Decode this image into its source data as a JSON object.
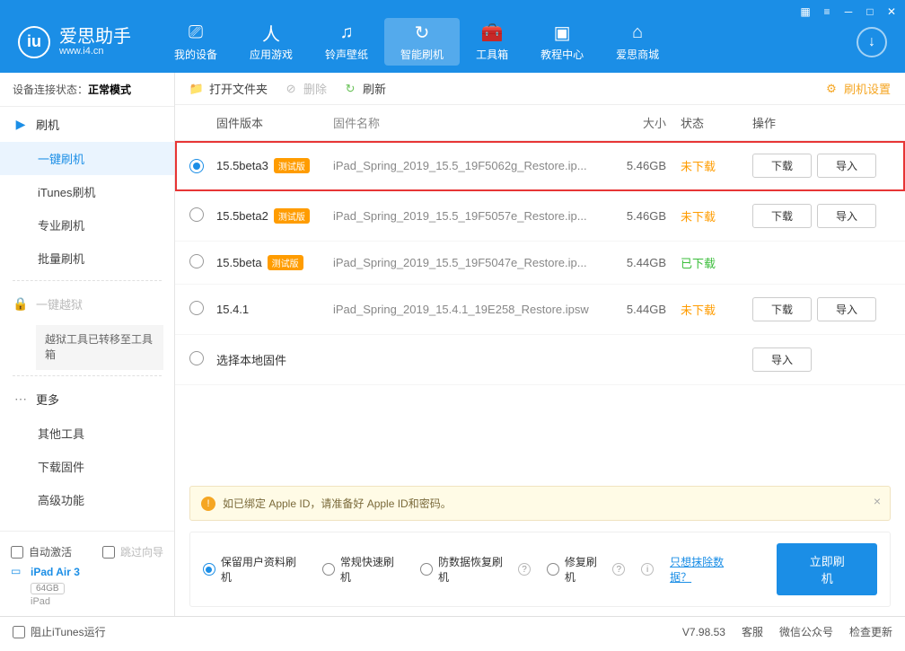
{
  "titlebar_icons": [
    "gift",
    "menu",
    "min",
    "max",
    "close"
  ],
  "logo": {
    "main": "爱思助手",
    "url": "www.i4.cn"
  },
  "nav": [
    {
      "label": "我的设备",
      "icon": "device"
    },
    {
      "label": "应用游戏",
      "icon": "apps"
    },
    {
      "label": "铃声壁纸",
      "icon": "ringtone"
    },
    {
      "label": "智能刷机",
      "icon": "refresh",
      "active": true
    },
    {
      "label": "工具箱",
      "icon": "toolbox"
    },
    {
      "label": "教程中心",
      "icon": "tutorial"
    },
    {
      "label": "爱思商城",
      "icon": "shop"
    }
  ],
  "conn_status": {
    "label": "设备连接状态：",
    "value": "正常模式"
  },
  "sidebar": {
    "group_flash": "刷机",
    "items_flash": [
      "一键刷机",
      "iTunes刷机",
      "专业刷机",
      "批量刷机"
    ],
    "group_jb": "一键越狱",
    "jb_note": "越狱工具已转移至工具箱",
    "group_more": "更多",
    "items_more": [
      "其他工具",
      "下载固件",
      "高级功能"
    ],
    "chk_autoact": "自动激活",
    "chk_skipguide": "跳过向导"
  },
  "device": {
    "name": "iPad Air 3",
    "capacity": "64GB",
    "type": "iPad"
  },
  "toolbar": {
    "open": "打开文件夹",
    "delete": "删除",
    "refresh": "刷新",
    "settings": "刷机设置"
  },
  "headers": {
    "version": "固件版本",
    "name": "固件名称",
    "size": "大小",
    "status": "状态",
    "op": "操作"
  },
  "rows": [
    {
      "sel": true,
      "ver": "15.5beta3",
      "beta": true,
      "name": "iPad_Spring_2019_15.5_19F5062g_Restore.ip...",
      "size": "5.46GB",
      "status": "未下载",
      "status_cls": "stat-undl",
      "ops": [
        "下载",
        "导入"
      ]
    },
    {
      "sel": false,
      "ver": "15.5beta2",
      "beta": true,
      "name": "iPad_Spring_2019_15.5_19F5057e_Restore.ip...",
      "size": "5.46GB",
      "status": "未下载",
      "status_cls": "stat-undl",
      "ops": [
        "下载",
        "导入"
      ]
    },
    {
      "sel": false,
      "ver": "15.5beta",
      "beta": true,
      "name": "iPad_Spring_2019_15.5_19F5047e_Restore.ip...",
      "size": "5.44GB",
      "status": "已下载",
      "status_cls": "stat-dl",
      "ops": []
    },
    {
      "sel": false,
      "ver": "15.4.1",
      "beta": false,
      "name": "iPad_Spring_2019_15.4.1_19E258_Restore.ipsw",
      "size": "5.44GB",
      "status": "未下载",
      "status_cls": "stat-undl",
      "ops": [
        "下载",
        "导入"
      ]
    },
    {
      "sel": false,
      "ver": "选择本地固件",
      "beta": false,
      "name": "",
      "size": "",
      "status": "",
      "status_cls": "",
      "ops": [
        "导入"
      ],
      "local": true
    }
  ],
  "beta_tag": "测试版",
  "notice": "如已绑定 Apple ID，请准备好 Apple ID和密码。",
  "flash_opts": [
    "保留用户资料刷机",
    "常规快速刷机",
    "防数据恢复刷机",
    "修复刷机"
  ],
  "erase_link": "只想抹除数据？",
  "flash_btn": "立即刷机",
  "footer": {
    "block_itunes": "阻止iTunes运行",
    "version": "V7.98.53",
    "service": "客服",
    "wechat": "微信公众号",
    "update": "检查更新"
  }
}
